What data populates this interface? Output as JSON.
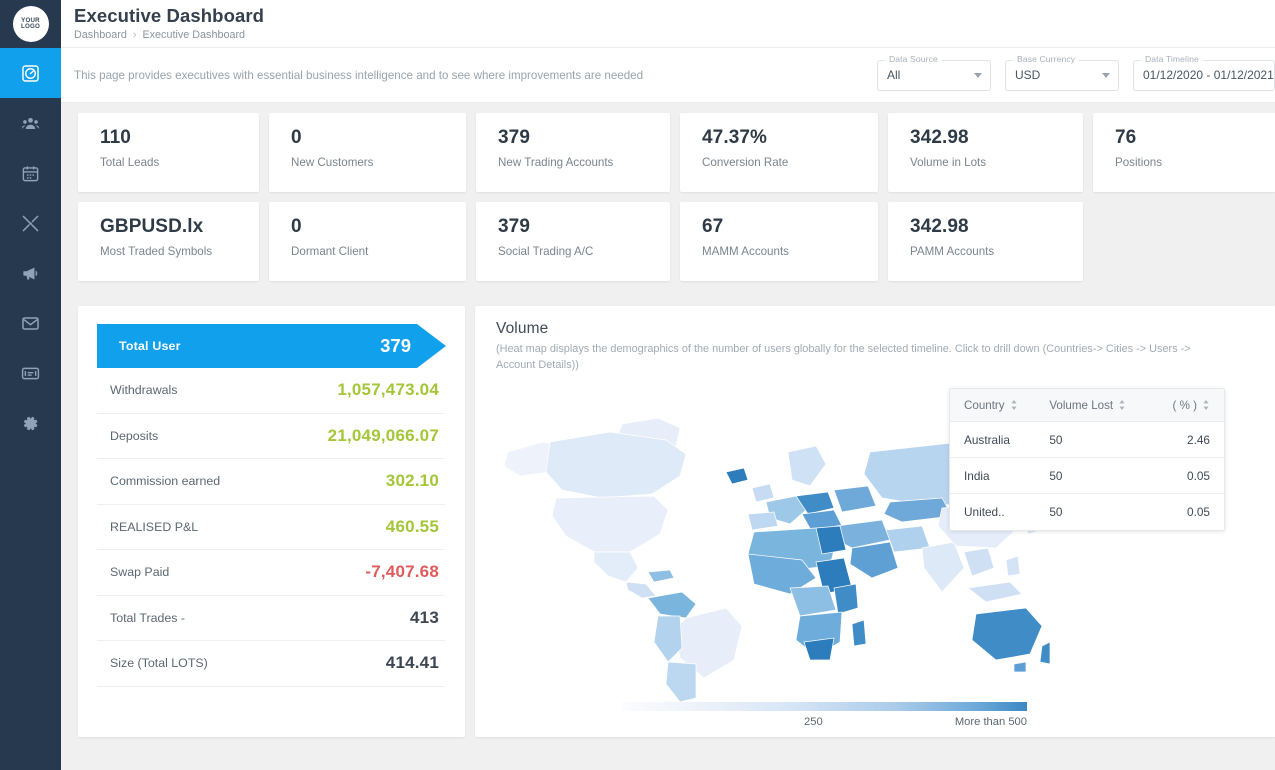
{
  "brand": {
    "logo_line1": "YOUR",
    "logo_line2": "LOGO"
  },
  "sidebar": {
    "items": [
      {
        "icon": "speedometer-icon",
        "name": "dashboard",
        "active": true
      },
      {
        "icon": "users-icon",
        "name": "customers",
        "active": false
      },
      {
        "icon": "calendar-icon",
        "name": "calendar",
        "active": false
      },
      {
        "icon": "tools-icon",
        "name": "tools",
        "active": false
      },
      {
        "icon": "megaphone-icon",
        "name": "marketing",
        "active": false
      },
      {
        "icon": "envelope-icon",
        "name": "mail",
        "active": false
      },
      {
        "icon": "card-icon",
        "name": "payments",
        "active": false
      },
      {
        "icon": "gear-icon",
        "name": "settings",
        "active": false
      }
    ]
  },
  "header": {
    "title": "Executive Dashboard",
    "breadcrumb_root": "Dashboard",
    "breadcrumb_sep": "›",
    "breadcrumb_current": "Executive Dashboard",
    "description": "This page provides executives with essential business intelligence and to see where improvements are needed"
  },
  "filters": {
    "data_source": {
      "legend": "Data Source",
      "value": "All"
    },
    "base_currency": {
      "legend": "Base Currency",
      "value": "USD"
    },
    "data_timeline": {
      "legend": "Data Timeline",
      "value": "01/12/2020 - 01/12/2021"
    }
  },
  "kpis_row1": [
    {
      "value": "110",
      "label": "Total Leads"
    },
    {
      "value": "0",
      "label": "New Customers"
    },
    {
      "value": "379",
      "label": "New Trading Accounts"
    },
    {
      "value": "47.37%",
      "label": "Conversion Rate"
    },
    {
      "value": "342.98",
      "label": "Volume in Lots"
    },
    {
      "value": "76",
      "label": "Positions"
    }
  ],
  "kpis_row2": [
    {
      "value": "GBPUSD.lx",
      "label": "Most Traded Symbols"
    },
    {
      "value": "0",
      "label": "Dormant Client"
    },
    {
      "value": "379",
      "label": "Social Trading A/C"
    },
    {
      "value": "67",
      "label": "MAMM Accounts"
    },
    {
      "value": "342.98",
      "label": "PAMM Accounts"
    }
  ],
  "stats": {
    "banner": {
      "label": "Total User",
      "value": "379"
    },
    "rows": [
      {
        "label": "Withdrawals",
        "value": "1,057,473.04",
        "tone": "green"
      },
      {
        "label": "Deposits",
        "value": "21,049,066.07",
        "tone": "green"
      },
      {
        "label": "Commission earned",
        "value": "302.10",
        "tone": "green"
      },
      {
        "label": "REALISED P&L",
        "value": "460.55",
        "tone": "green"
      },
      {
        "label": "Swap Paid",
        "value": "-7,407.68",
        "tone": "red"
      },
      {
        "label": "Total Trades -",
        "value": "413",
        "tone": "dark"
      },
      {
        "label": "Size (Total LOTS)",
        "value": "414.41",
        "tone": "dark"
      }
    ]
  },
  "volume": {
    "title": "Volume",
    "subtitle": "(Heat map displays the demographics of the number of users globally for the selected timeline. Click to drill down (Countries-> Cities -> Users -> Account Details))",
    "legend": {
      "mid": "250",
      "max": "More than 500"
    },
    "table": {
      "columns": [
        "Country",
        "Volume Lost",
        "( % )"
      ],
      "rows": [
        [
          "Australia",
          "50",
          "2.46"
        ],
        [
          "India",
          "50",
          "0.05"
        ],
        [
          "United..",
          "50",
          "0.05"
        ]
      ]
    }
  },
  "chart_data": {
    "type": "heatmap",
    "title": "Volume",
    "subtitle": "(Heat map displays the demographics of the number of users globally for the selected timeline. Click to drill down (Countries-> Cities -> Users -> Account Details))",
    "colorbar": {
      "min_label": "",
      "mid_label": "250",
      "max_label": "More than 500",
      "range": [
        0,
        500
      ],
      "colors": [
        "#fbfcfe",
        "#3d87c4"
      ]
    },
    "countries": [
      {
        "name": "Australia",
        "volume_lost": 50,
        "percent": 2.46
      },
      {
        "name": "India",
        "volume_lost": 50,
        "percent": 0.05
      },
      {
        "name": "United..",
        "volume_lost": 50,
        "percent": 0.05
      }
    ]
  },
  "colors": {
    "accent": "#11a0ec",
    "sidebar": "#26394f",
    "positive": "#a4c639",
    "negative": "#e05c5c",
    "page_bg": "#f0f0f0"
  }
}
